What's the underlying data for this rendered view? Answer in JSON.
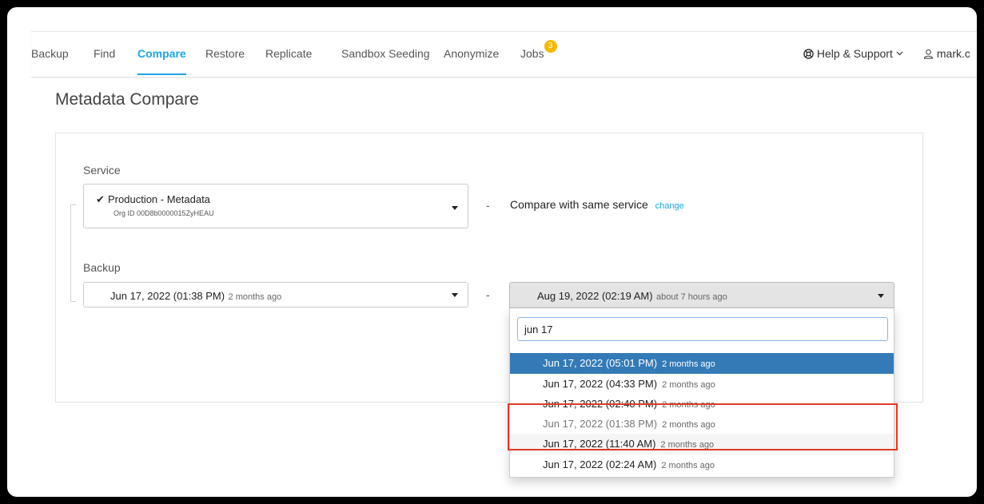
{
  "nav": {
    "tabs": [
      {
        "label": "Backup"
      },
      {
        "label": "Find"
      },
      {
        "label": "Compare"
      },
      {
        "label": "Restore"
      },
      {
        "label": "Replicate"
      },
      {
        "label": "Sandbox Seeding"
      },
      {
        "label": "Anonymize"
      },
      {
        "label": "Jobs",
        "badge": "3"
      }
    ],
    "active_tab": "Compare",
    "help_label": "Help & Support",
    "user_label": "mark.c"
  },
  "page": {
    "title": "Metadata Compare"
  },
  "service": {
    "label": "Service",
    "selected_name": "Production - Metadata",
    "org_id": "Org ID 00D8b0000015ZyHEAU",
    "compare_text": "Compare with same service",
    "change_link": "change"
  },
  "backup": {
    "label": "Backup",
    "left_date": "Jun 17, 2022 (01:38 PM)",
    "left_relative": "2 months ago",
    "right_date": "Aug 19, 2022 (02:19 AM)",
    "right_relative": "about 7 hours ago"
  },
  "dropdown": {
    "search_value": "jun 17",
    "items": [
      {
        "date": "Jun 17, 2022 (05:01 PM)",
        "relative": "2 months ago",
        "state": "selected"
      },
      {
        "date": "Jun 17, 2022 (04:33 PM)",
        "relative": "2 months ago",
        "state": "normal"
      },
      {
        "date": "Jun 17, 2022 (02:40 PM)",
        "relative": "2 months ago",
        "state": "normal"
      },
      {
        "date": "Jun 17, 2022 (01:38 PM)",
        "relative": "2 months ago",
        "state": "disabled"
      },
      {
        "date": "Jun 17, 2022 (11:40 AM)",
        "relative": "2 months ago",
        "state": "hover"
      },
      {
        "date": "Jun 17, 2022 (02:24 AM)",
        "relative": "2 months ago",
        "state": "normal"
      }
    ]
  },
  "colors": {
    "accent": "#1ba5e0",
    "selected_row": "#337ab7",
    "badge": "#f5b800",
    "annotation": "#e03a25"
  }
}
